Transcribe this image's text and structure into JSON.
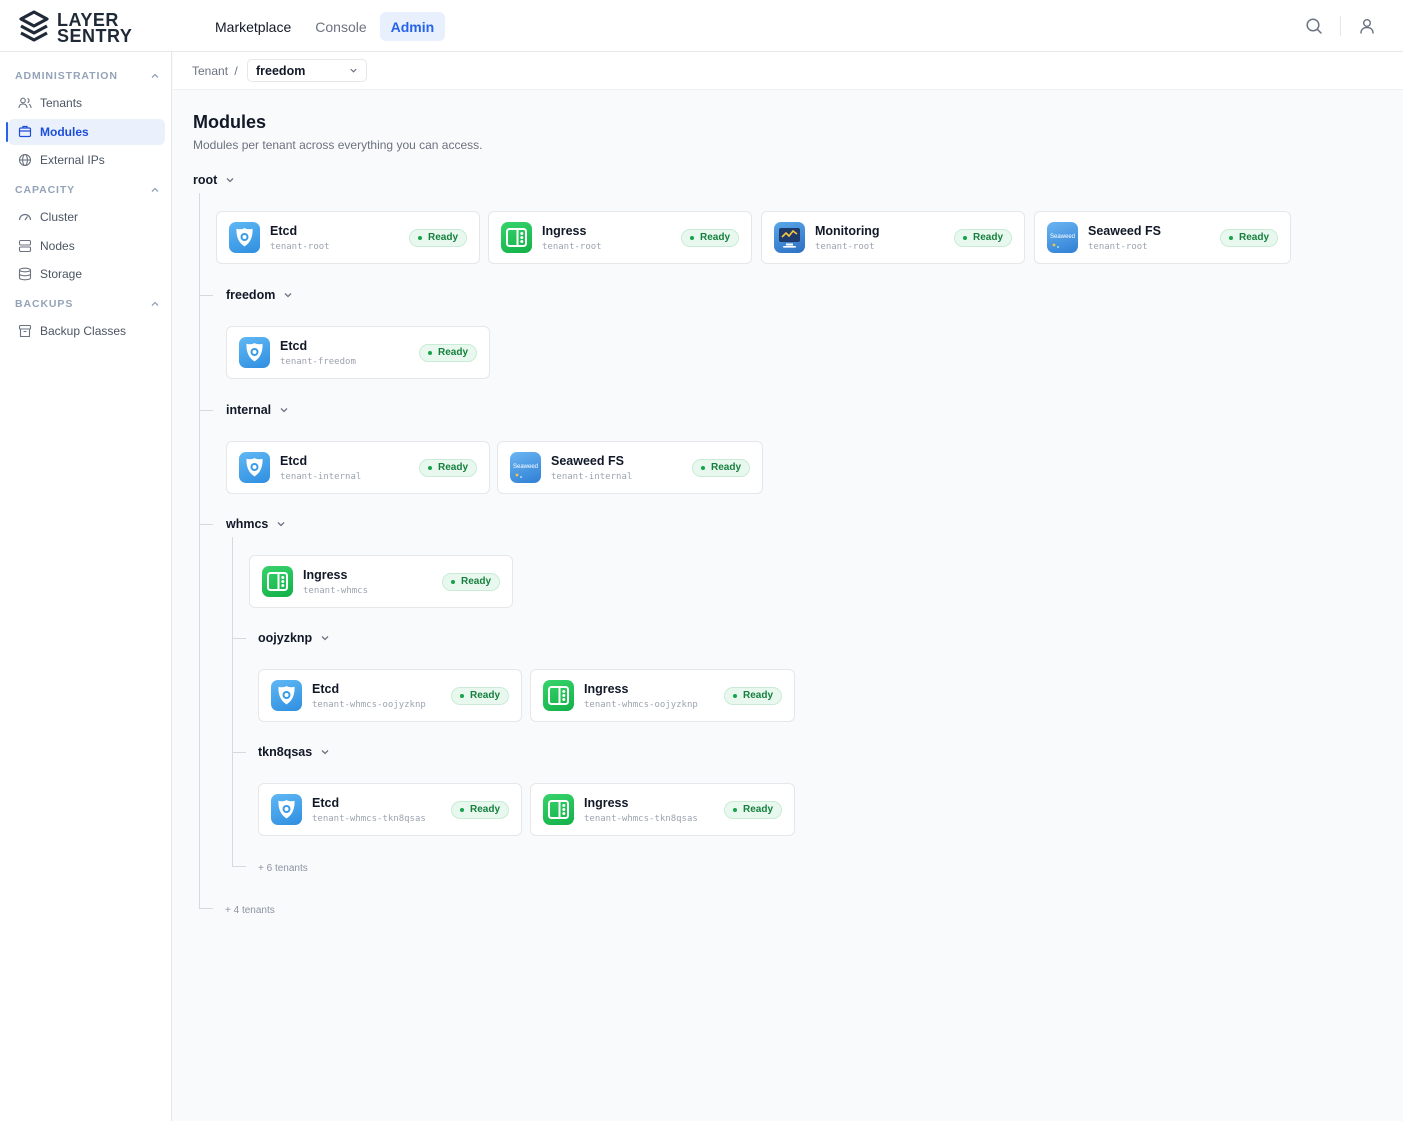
{
  "brand": {
    "line1": "LAYER",
    "line2": "SENTRY"
  },
  "nav": {
    "marketplace": "Marketplace",
    "console": "Console",
    "admin": "Admin"
  },
  "sidebar": {
    "administration": {
      "title": "ADMINISTRATION",
      "items": [
        {
          "label": "Tenants",
          "icon": "users-icon"
        },
        {
          "label": "Modules",
          "icon": "package-icon"
        },
        {
          "label": "External IPs",
          "icon": "globe-icon"
        }
      ]
    },
    "capacity": {
      "title": "CAPACITY",
      "items": [
        {
          "label": "Cluster",
          "icon": "gauge-icon"
        },
        {
          "label": "Nodes",
          "icon": "server-icon"
        },
        {
          "label": "Storage",
          "icon": "database-icon"
        }
      ]
    },
    "backups": {
      "title": "BACKUPS",
      "items": [
        {
          "label": "Backup Classes",
          "icon": "archive-icon"
        }
      ]
    }
  },
  "breadcrumb": {
    "label": "Tenant",
    "separator": "/",
    "selected": "freedom"
  },
  "page": {
    "title": "Modules",
    "subtitle": "Modules per tenant across everything you can access."
  },
  "tenants": {
    "root": {
      "name": "root",
      "modules": [
        {
          "name": "Etcd",
          "ns": "tenant-root",
          "status": "Ready",
          "icon": "etcd-icon"
        },
        {
          "name": "Ingress",
          "ns": "tenant-root",
          "status": "Ready",
          "icon": "ingress-icon"
        },
        {
          "name": "Monitoring",
          "ns": "tenant-root",
          "status": "Ready",
          "icon": "monitoring-icon"
        },
        {
          "name": "Seaweed FS",
          "ns": "tenant-root",
          "status": "Ready",
          "icon": "seaweedfs-icon",
          "icon_text": "Seaweed"
        }
      ]
    },
    "freedom": {
      "name": "freedom",
      "modules": [
        {
          "name": "Etcd",
          "ns": "tenant-freedom",
          "status": "Ready",
          "icon": "etcd-icon"
        }
      ]
    },
    "internal": {
      "name": "internal",
      "modules": [
        {
          "name": "Etcd",
          "ns": "tenant-internal",
          "status": "Ready",
          "icon": "etcd-icon"
        },
        {
          "name": "Seaweed FS",
          "ns": "tenant-internal",
          "status": "Ready",
          "icon": "seaweedfs-icon",
          "icon_text": "Seaweed"
        }
      ]
    },
    "whmcs": {
      "name": "whmcs",
      "modules": [
        {
          "name": "Ingress",
          "ns": "tenant-whmcs",
          "status": "Ready",
          "icon": "ingress-icon"
        }
      ]
    },
    "oojyzknp": {
      "name": "oojyzknp",
      "modules": [
        {
          "name": "Etcd",
          "ns": "tenant-whmcs-oojyzknp",
          "status": "Ready",
          "icon": "etcd-icon"
        },
        {
          "name": "Ingress",
          "ns": "tenant-whmcs-oojyzknp",
          "status": "Ready",
          "icon": "ingress-icon"
        }
      ]
    },
    "tkn8qsas": {
      "name": "tkn8qsas",
      "modules": [
        {
          "name": "Etcd",
          "ns": "tenant-whmcs-tkn8qsas",
          "status": "Ready",
          "icon": "etcd-icon"
        },
        {
          "name": "Ingress",
          "ns": "tenant-whmcs-tkn8qsas",
          "status": "Ready",
          "icon": "ingress-icon"
        }
      ]
    }
  },
  "more": {
    "whmcs": "+ 6 tenants",
    "root": "+ 4 tenants"
  },
  "colors": {
    "accent": "#2563eb",
    "ready_bg": "#e9f8ef",
    "ready_text": "#15803d",
    "brand": "#1f2937"
  }
}
